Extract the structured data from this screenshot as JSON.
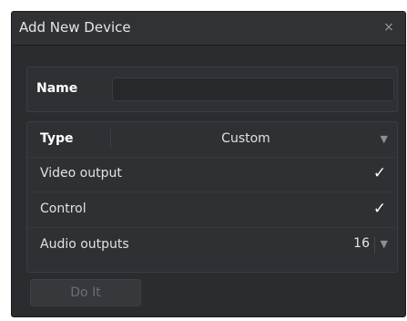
{
  "dialog": {
    "title": "Add New Device",
    "close_glyph": "×"
  },
  "name_field": {
    "label": "Name",
    "value": "",
    "placeholder": ""
  },
  "type_field": {
    "label": "Type",
    "selected": "Custom"
  },
  "options": [
    {
      "label": "Video output",
      "checked": true,
      "check_glyph": "✓"
    },
    {
      "label": "Control",
      "checked": true,
      "check_glyph": "✓"
    }
  ],
  "audio_outputs": {
    "label": "Audio outputs",
    "value": "16"
  },
  "dropdown_glyph": "▼",
  "submit": {
    "label": "Do It",
    "disabled": true
  },
  "colors": {
    "background": "#2a2c2f",
    "panel": "#2e3034",
    "text": "#e2e2e2",
    "disabled_text": "#6c6e73"
  }
}
